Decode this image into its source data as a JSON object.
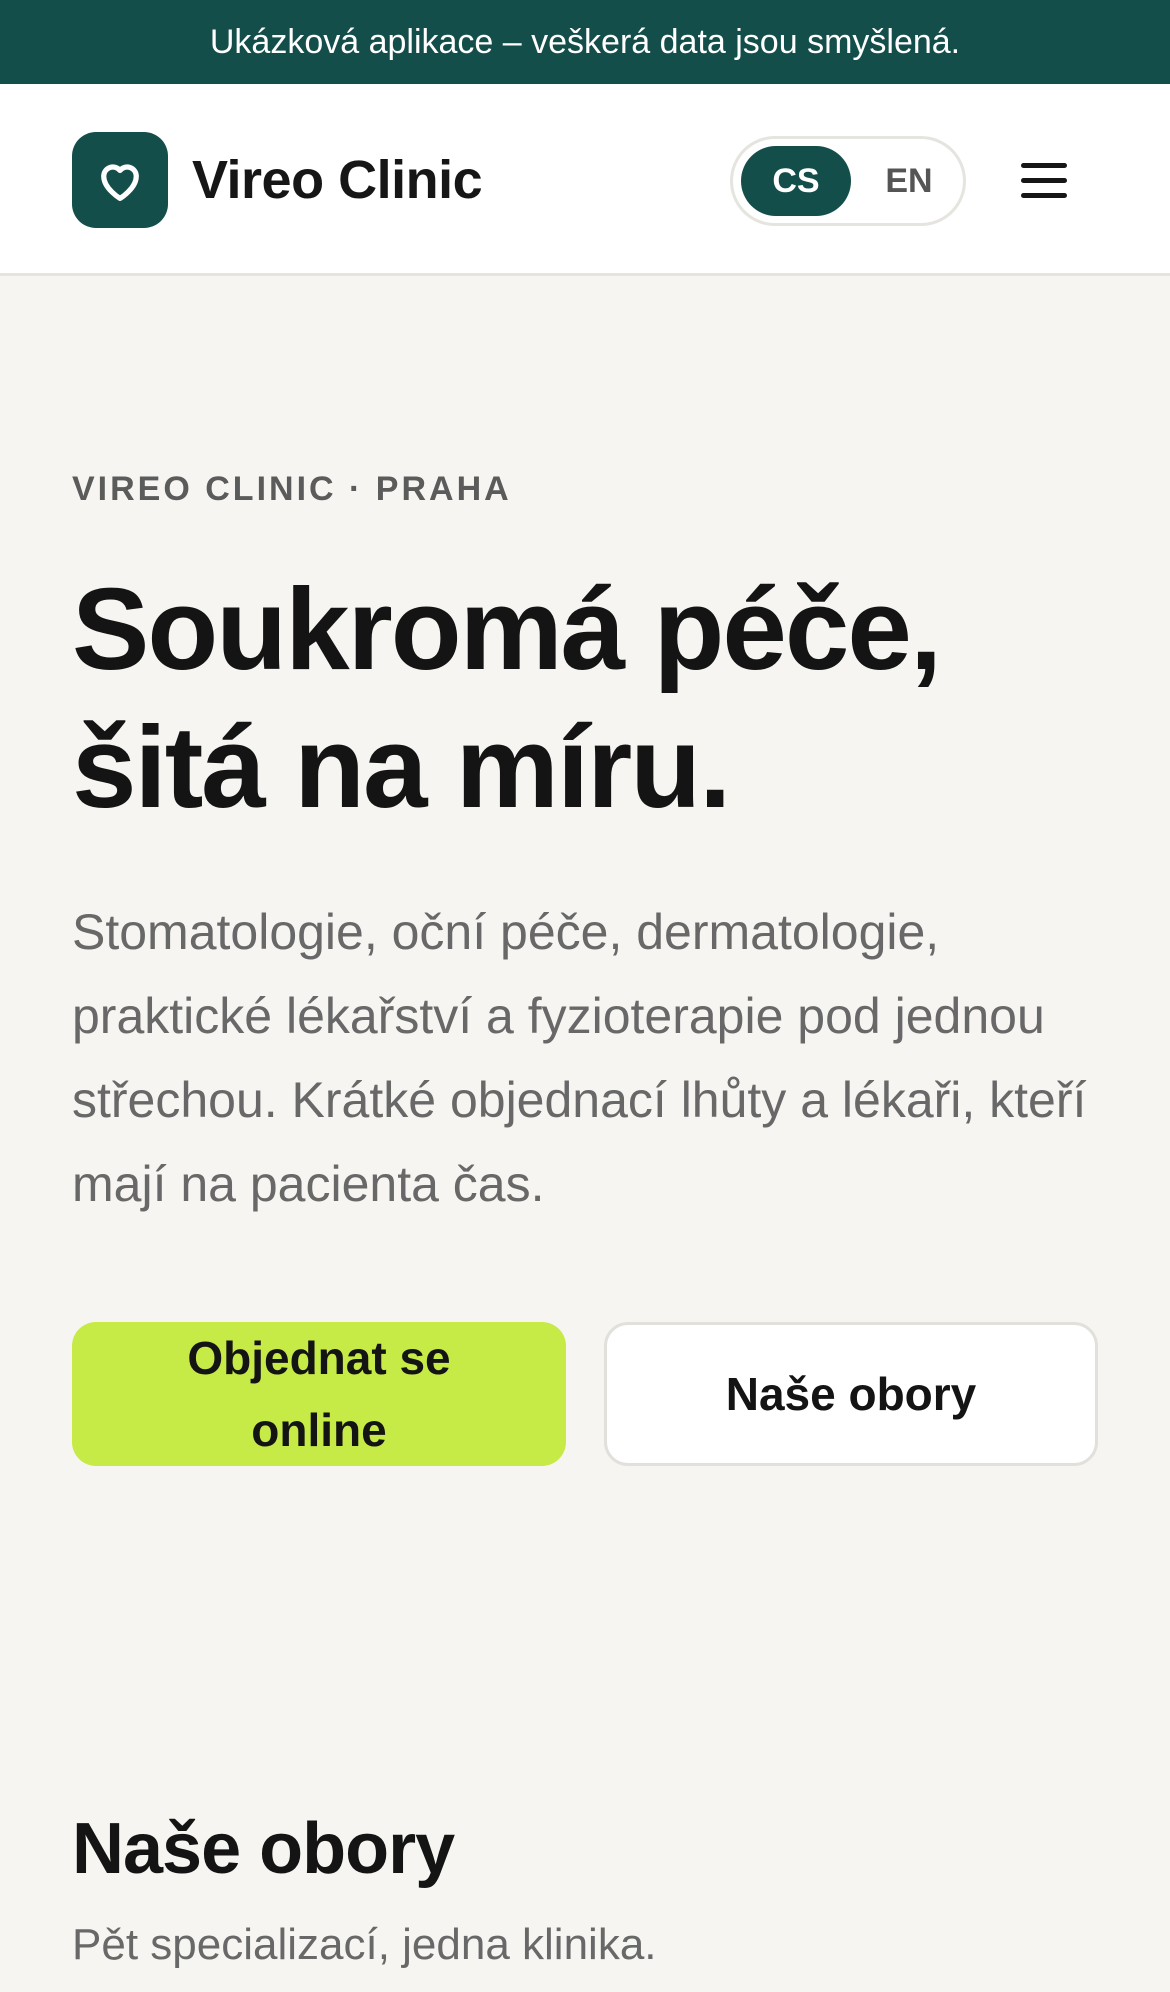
{
  "banner": {
    "text": "Ukázková aplikace – veškerá data jsou smyšlená."
  },
  "header": {
    "brand": "Vireo Clinic",
    "logo_icon": "heart-icon",
    "lang": {
      "active": "CS",
      "inactive": "EN"
    },
    "menu_icon": "hamburger-menu-icon"
  },
  "hero": {
    "eyebrow": "VIREO CLINIC · PRAHA",
    "title_line1": "Soukromá péče,",
    "title_line2": "šitá na míru.",
    "description": "Stomatologie, oční péče, dermatologie, praktické lékařství a fyzioterapie pod jednou střechou. Krátké objednací lhůty a lékaři, kteří mají na pacienta čas.",
    "primary_button": "Objednat se online",
    "secondary_button": "Naše obory"
  },
  "specialties": {
    "title": "Naše obory",
    "subtitle": "Pět specializací, jedna klinika."
  },
  "colors": {
    "brand": "#134e4a",
    "accent": "#c6ea46",
    "background": "#f6f5f2"
  }
}
